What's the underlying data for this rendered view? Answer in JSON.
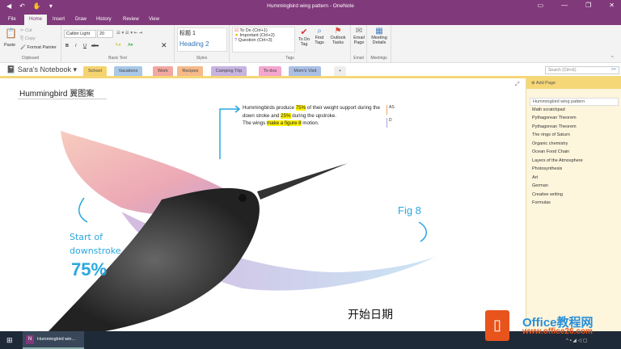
{
  "window": {
    "title": "Hummingbird wing pattern - OneNote"
  },
  "ribbon_tabs": [
    "File",
    "Home",
    "Insert",
    "Draw",
    "History",
    "Review",
    "View"
  ],
  "clipboard": {
    "paste": "Paste",
    "cut": "Cut",
    "copy": "Copy",
    "format_painter": "Format Painter",
    "label": "Clipboard"
  },
  "basic_text": {
    "font": "Calibri Light",
    "size": "20",
    "bold": "B",
    "italic": "I",
    "underline": "U",
    "strike": "abc",
    "label": "Basic Text"
  },
  "styles": {
    "style1": "标题 1",
    "style2": "Heading 2",
    "label": "Styles"
  },
  "tags": {
    "items": [
      "To Do (Ctrl+1)",
      "Important (Ctrl+2)",
      "Question (Ctrl+3)"
    ],
    "todo_tag": "To Do Tag",
    "find_tags": "Find Tags",
    "outlook_tasks": "Outlook Tasks",
    "label": "Tags"
  },
  "email": {
    "button": "Email Page",
    "label": "Email"
  },
  "meetings": {
    "button": "Meeting Details",
    "label": "Meetings"
  },
  "notebook": {
    "name": "Sara's Notebook"
  },
  "sections": [
    {
      "label": "School",
      "color": "#f5d36e"
    },
    {
      "label": "Vacations",
      "color": "#a9c8e8"
    },
    {
      "label": "Work",
      "color": "#f2a7a0"
    },
    {
      "label": "Recipes",
      "color": "#f5b98a"
    },
    {
      "label": "Camping Trip",
      "color": "#c7b3e0"
    },
    {
      "label": "To-dos",
      "color": "#f4a6cf"
    },
    {
      "label": "Mom's Visit",
      "color": "#a9bfe6"
    },
    {
      "label": "+",
      "color": "#eeeeee"
    }
  ],
  "search": {
    "placeholder": "Search (Ctrl+E)"
  },
  "page": {
    "title": "Hummingbird 翼图案",
    "note": {
      "p1a": "Hummingbirds produce ",
      "h1": "75%",
      "p1b": " of their weight support during the down stroke and ",
      "h2": "25%",
      "p1c": " during the upstroke.",
      "p2a": "The wings ",
      "h3": "make a figure 8",
      "p2b": " motion."
    },
    "side_marks": [
      "AS",
      "D"
    ],
    "ink": {
      "start": "Start of",
      "downstroke": "downstroke",
      "pct": "75%",
      "fig": "Fig 8",
      "date": "开始日期"
    }
  },
  "pages_panel": {
    "add_page": "Add Page",
    "pages": [
      "Hummingbird wing pattern",
      "Math scratchpad",
      "Pythagorean Theorem",
      "Pythagorean Theorem",
      "The rings of Saturn",
      "Organic chemistry",
      "Ocean Food Chain",
      "Layers of the Atmosphere",
      "Photosynthesis",
      "Art",
      "German",
      "Creative writing",
      "Formulas"
    ]
  },
  "taskbar": {
    "app": "Hummingbird win..."
  },
  "watermark": {
    "line1": "Office教程网",
    "line2": "www.office26.com"
  }
}
